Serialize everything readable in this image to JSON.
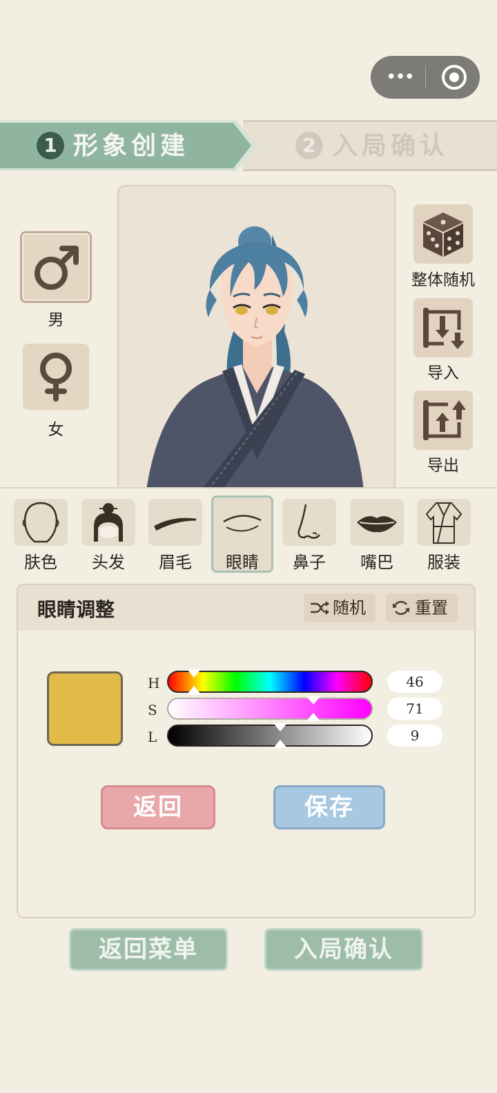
{
  "capsule": {
    "menu_icon": "more-dots-icon",
    "close_icon": "target-circle-icon"
  },
  "steps": {
    "step1": {
      "number": "1",
      "label": "形象创建"
    },
    "step2": {
      "number": "2",
      "label": "入局确认"
    }
  },
  "gender": {
    "male_label": "男",
    "female_label": "女",
    "selected": "男"
  },
  "side_actions": {
    "random_all": "整体随机",
    "import": "导入",
    "export": "导出"
  },
  "categories": [
    {
      "label": "肤色",
      "icon": "face-outline-icon"
    },
    {
      "label": "头发",
      "icon": "hair-bun-icon"
    },
    {
      "label": "眉毛",
      "icon": "eyebrow-icon"
    },
    {
      "label": "眼睛",
      "icon": "eye-icon"
    },
    {
      "label": "鼻子",
      "icon": "nose-icon"
    },
    {
      "label": "嘴巴",
      "icon": "lips-icon"
    },
    {
      "label": "服装",
      "icon": "robe-icon"
    }
  ],
  "selected_category": "眼睛",
  "panel": {
    "title": "眼睛调整",
    "random_label": "随机",
    "reset_label": "重置",
    "swatch_color": "#e2ba4a",
    "sliders": [
      {
        "label": "H",
        "value": "46",
        "fraction": 0.13
      },
      {
        "label": "S",
        "value": "71",
        "fraction": 0.71
      },
      {
        "label": "L",
        "value": "9",
        "fraction": 0.55
      }
    ],
    "back_label": "返回",
    "save_label": "保存"
  },
  "footer": {
    "menu_label": "返回菜单",
    "confirm_label": "入局确认"
  },
  "colors": {
    "background": "#f3eee2",
    "step_active": "#8fb5a0",
    "back_button": "#e8a7a9",
    "save_button": "#a7c8e0",
    "footer_button": "#9dbda9"
  }
}
